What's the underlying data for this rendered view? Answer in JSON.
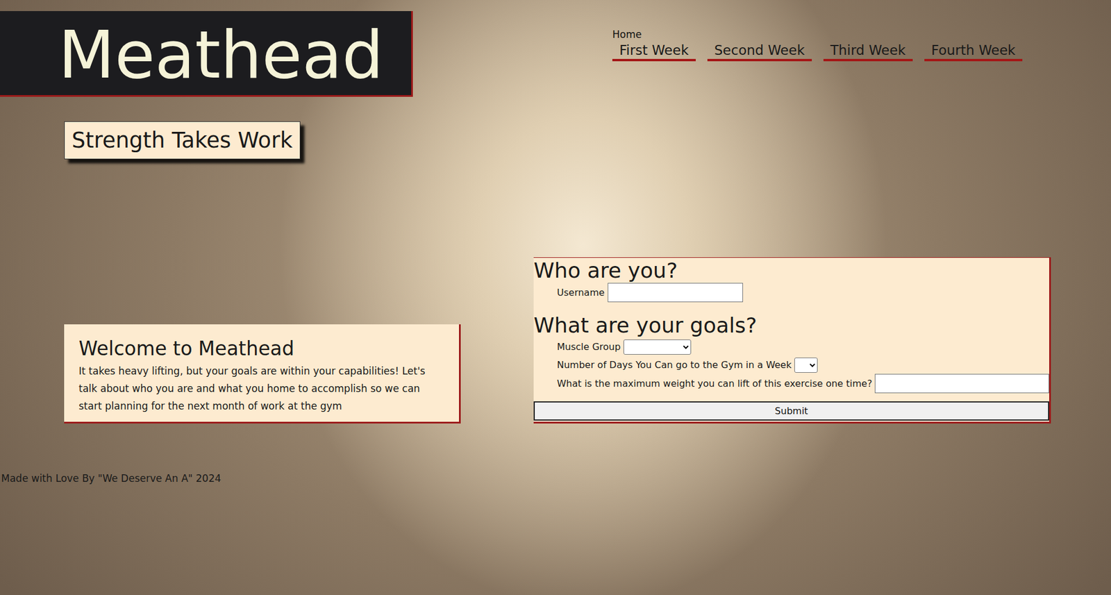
{
  "header": {
    "title": "Meathead",
    "tagline": "Strength Takes Work"
  },
  "nav": {
    "home": "Home",
    "links": [
      {
        "label": "First Week"
      },
      {
        "label": "Second Week"
      },
      {
        "label": "Third Week"
      },
      {
        "label": "Fourth Week"
      }
    ]
  },
  "welcome": {
    "title": "Welcome to Meathead",
    "body": "It takes heavy lifting, but your goals are within your capabilities! Let's talk about who you are and what you home to accomplish so we can start planning for the next month of work at the gym"
  },
  "form": {
    "sections": [
      {
        "title": "Who are you?",
        "fields": [
          {
            "label": "Username",
            "kind": "text",
            "value": ""
          }
        ]
      },
      {
        "title": "What are your goals?",
        "fields": [
          {
            "label": "Muscle Group",
            "kind": "select",
            "value": ""
          },
          {
            "label": "Number of Days You Can go to the Gym in a Week",
            "kind": "count",
            "value": ""
          },
          {
            "label": "What is the maximum weight you can lift of this exercise one time?",
            "kind": "number",
            "value": ""
          }
        ]
      }
    ],
    "submit": "Submit"
  },
  "footer": "Made with Love By \"We Deserve An A\" 2024"
}
